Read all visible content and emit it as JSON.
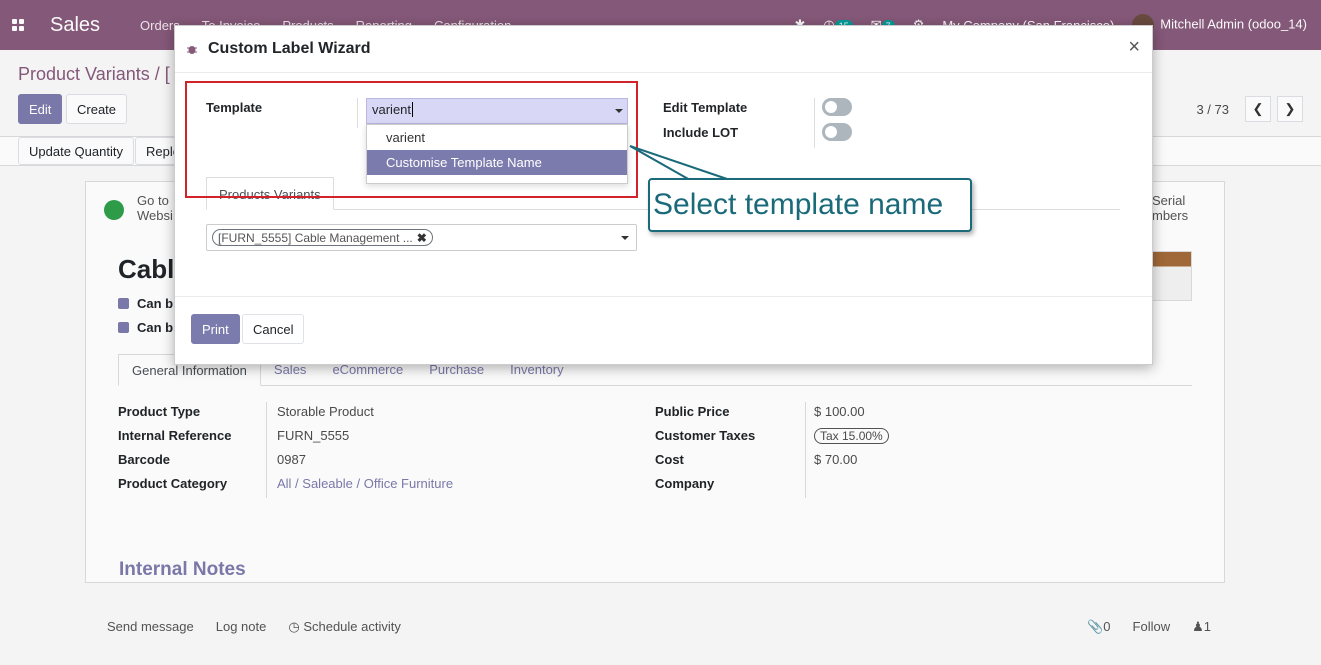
{
  "navbar": {
    "app_name": "Sales",
    "menu": [
      "Orders",
      "To Invoice",
      "Products",
      "Reporting",
      "Configuration"
    ],
    "activity_count": "15",
    "message_count": "7",
    "company": "My Company (San Francisco)",
    "user": "Mitchell Admin (odoo_14)"
  },
  "background": {
    "breadcrumb": "Product Variants / [",
    "edit_label": "Edit",
    "create_label": "Create",
    "pager": "3 / 73",
    "update_quantity_label": "Update Quantity",
    "replenish_label": "Reple",
    "go_to_website": [
      "Go to",
      "Websi"
    ],
    "serial_numbers": [
      "Serial",
      "mbers"
    ],
    "product_title": "Cabl",
    "checkbox_labels": [
      "Can b",
      "Can b"
    ],
    "tabs": [
      "General Information",
      "Sales",
      "eCommerce",
      "Purchase",
      "Inventory"
    ],
    "left_fields": [
      {
        "label": "Product Type",
        "value": "Storable Product"
      },
      {
        "label": "Internal Reference",
        "value": "FURN_5555"
      },
      {
        "label": "Barcode",
        "value": "0987"
      },
      {
        "label": "Product Category",
        "value": "All / Saleable / Office Furniture"
      }
    ],
    "right_fields": [
      {
        "label": "Public Price",
        "value": "$ 100.00"
      },
      {
        "label": "Customer Taxes",
        "value": "Tax 15.00%"
      },
      {
        "label": "Cost",
        "value": "$ 70.00"
      },
      {
        "label": "Company",
        "value": ""
      }
    ],
    "internal_notes": "Internal Notes",
    "chatter": {
      "send_message": "Send message",
      "log_note": "Log note",
      "schedule_activity": "Schedule activity",
      "attachments": "0",
      "follow": "Follow",
      "followers": "1"
    }
  },
  "modal": {
    "title": "Custom Label Wizard",
    "template_label": "Template",
    "template_value": "varient",
    "dropdown_options": [
      "varient",
      "Customise Template Name"
    ],
    "edit_template_label": "Edit Template",
    "include_lot_label": "Include LOT",
    "tab_label": "Products Variants",
    "product_tag": "[FURN_5555] Cable Management ...",
    "print_label": "Print",
    "cancel_label": "Cancel"
  },
  "annotation": {
    "callout_text": "Select template name",
    "box_color": "#d2232a",
    "callout_color": "#1a6a7a"
  },
  "colors": {
    "brand": "#875a7b",
    "primary": "#7c7bad"
  }
}
